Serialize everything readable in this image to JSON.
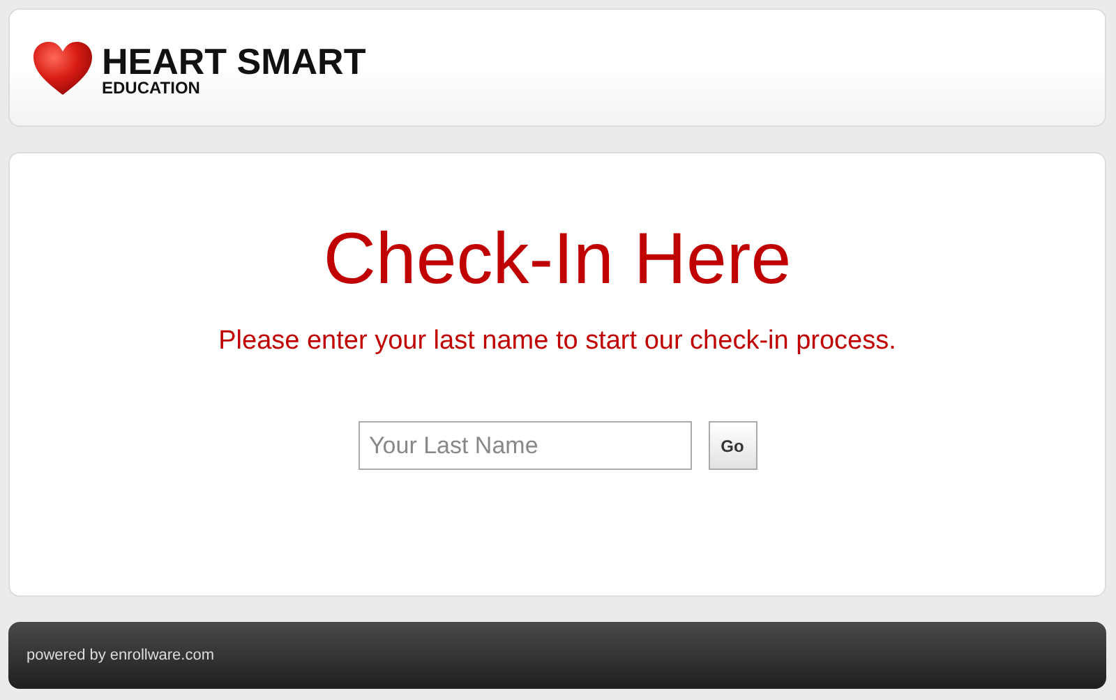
{
  "header": {
    "brand": "HEART SMART",
    "tagline": "EDUCATION"
  },
  "main": {
    "title": "Check-In Here",
    "subtitle": "Please enter your last name to start our check-in process.",
    "field": {
      "placeholder": "Your Last Name"
    },
    "button": "Go"
  },
  "footer": {
    "text": "powered by enrollware.com"
  }
}
